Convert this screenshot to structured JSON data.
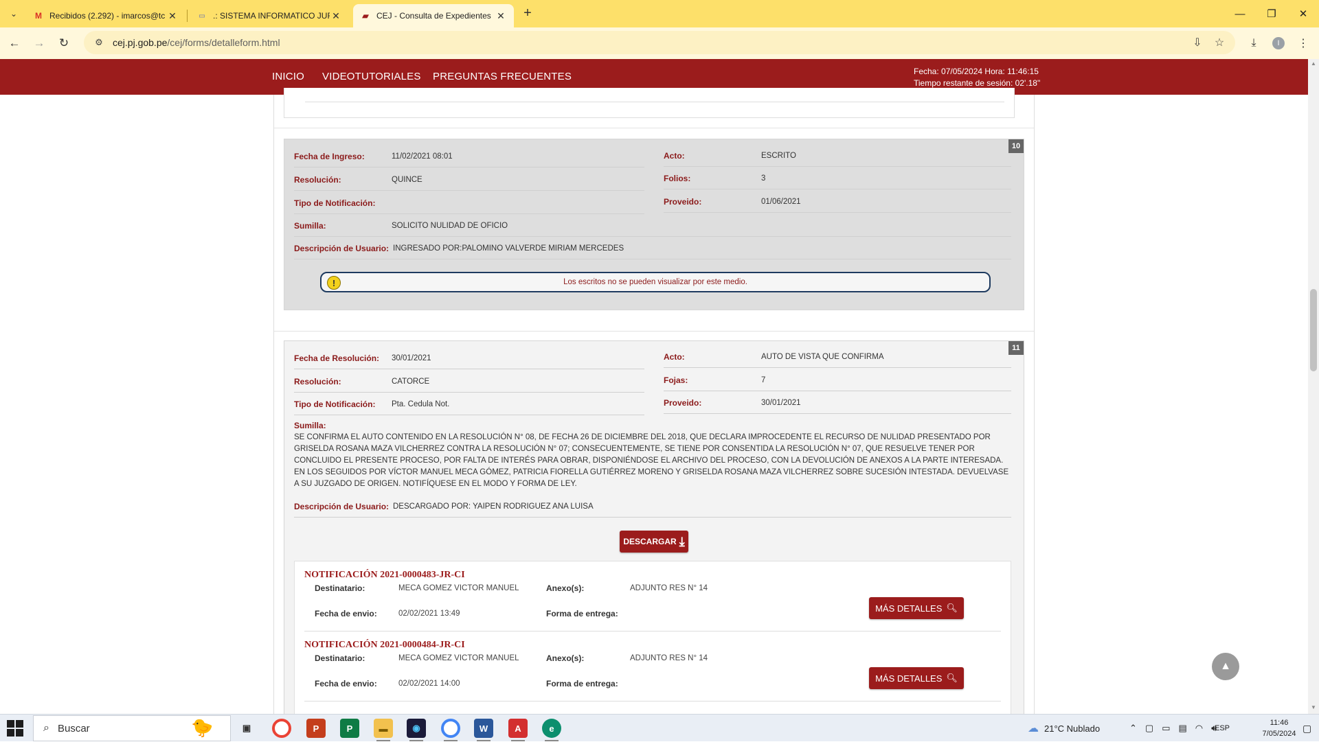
{
  "browser": {
    "tabs": [
      {
        "title": "Recibidos (2.292) - imarcos@tc",
        "favicon": "gmail-icon",
        "active": false
      },
      {
        "title": ".: SISTEMA INFORMATICO JURI",
        "favicon": "page-icon",
        "active": false
      },
      {
        "title": "CEJ - Consulta de Expedientes",
        "favicon": "pj-icon",
        "active": true
      }
    ],
    "url_host": "cej.pj.gob.pe",
    "url_path": "/cej/forms/detalleform.html"
  },
  "site": {
    "nav": [
      "INICIO",
      "VIDEOTUTORIALES",
      "PREGUNTAS FRECUENTES"
    ],
    "session_date_line": "Fecha: 07/05/2024 Hora: 11:46:15",
    "session_time_line": "Tiempo restante de sesión: 02'.18\""
  },
  "records": [
    {
      "number": "10",
      "fields_left": [
        {
          "label": "Fecha de Ingreso:",
          "value": "11/02/2021 08:01"
        },
        {
          "label": "Resolución:",
          "value": "QUINCE"
        },
        {
          "label": "Tipo de Notificación:",
          "value": ""
        },
        {
          "label": "Sumilla:",
          "value": "SOLICITO NULIDAD DE OFICIO"
        },
        {
          "label": "Descripción de Usuario:",
          "value": "INGRESADO POR:PALOMINO VALVERDE MIRIAM MERCEDES"
        }
      ],
      "fields_right": [
        {
          "label": "Acto:",
          "value": "ESCRITO"
        },
        {
          "label": "Folios:",
          "value": "3"
        },
        {
          "label": "Proveido:",
          "value": "01/06/2021"
        }
      ],
      "notice": "Los escritos no se pueden visualizar por este medio."
    },
    {
      "number": "11",
      "fields_left": [
        {
          "label": "Fecha de Resolución:",
          "value": "30/01/2021"
        },
        {
          "label": "Resolución:",
          "value": "CATORCE"
        },
        {
          "label": "Tipo de Notificación:",
          "value": "Pta. Cedula Not."
        }
      ],
      "fields_right": [
        {
          "label": "Acto:",
          "value": "AUTO DE VISTA QUE CONFIRMA"
        },
        {
          "label": "Fojas:",
          "value": "7"
        },
        {
          "label": "Proveido:",
          "value": "30/01/2021"
        }
      ],
      "sumilla_label": "Sumilla:",
      "sumilla_text": "SE CONFIRMA EL AUTO CONTENIDO EN LA RESOLUCIÓN N° 08, DE FECHA 26 DE DICIEMBRE DEL 2018, QUE DECLARA IMPROCEDENTE EL RECURSO DE NULIDAD PRESENTADO POR GRISELDA ROSANA MAZA VILCHERREZ CONTRA LA RESOLUCIÓN N° 07; CONSECUENTEMENTE, SE TIENE POR CONSENTIDA LA RESOLUCIÓN N° 07, QUE RESUELVE TENER POR CONCLUIDO EL PRESENTE PROCESO, POR FALTA DE INTERÉS PARA OBRAR, DISPONIÉNDOSE EL ARCHIVO DEL PROCESO, CON LA DEVOLUCIÓN DE ANEXOS A LA PARTE INTERESADA. EN LOS SEGUIDOS POR VÍCTOR MANUEL MECA GÓMEZ, PATRICIA FIORELLA GUTIÉRREZ MORENO Y GRISELDA ROSANA MAZA VILCHERREZ SOBRE SUCESIÓN INTESTADA. DEVUELVASE A SU JUZGADO DE ORIGEN. NOTIFÍQUESE EN EL MODO Y FORMA DE LEY.",
      "user_desc_label": "Descripción de Usuario:",
      "user_desc_value": "DESCARGADO POR: YAIPEN RODRIGUEZ ANA LUISA",
      "download_label": "DESCARGAR",
      "notifications": [
        {
          "title": "NOTIFICACIÓN 2021-0000483-JR-CI",
          "recipient_label": "Destinatario:",
          "recipient": "MECA GOMEZ VICTOR MANUEL",
          "annex_label": "Anexo(s):",
          "annex": "ADJUNTO RES N° 14",
          "sent_label": "Fecha de envio:",
          "sent": "02/02/2021 13:49",
          "delivery_label": "Forma de entrega:",
          "delivery": "",
          "button": "MÁS DETALLES"
        },
        {
          "title": "NOTIFICACIÓN 2021-0000484-JR-CI",
          "recipient_label": "Destinatario:",
          "recipient": "MECA GOMEZ VICTOR MANUEL",
          "annex_label": "Anexo(s):",
          "annex": "ADJUNTO RES N° 14",
          "sent_label": "Fecha de envio:",
          "sent": "02/02/2021 14:00",
          "delivery_label": "Forma de entrega:",
          "delivery": "",
          "button": "MÁS DETALLES"
        }
      ]
    }
  ],
  "taskbar": {
    "search_placeholder": "Buscar",
    "weather": "21°C  Nublado",
    "lang": "ESP",
    "time": "11:46",
    "date": "7/05/2024"
  },
  "colors": {
    "brand_red": "#9b1c1c",
    "label_red": "#8b1a1a",
    "tab_strip": "#fde06a"
  }
}
